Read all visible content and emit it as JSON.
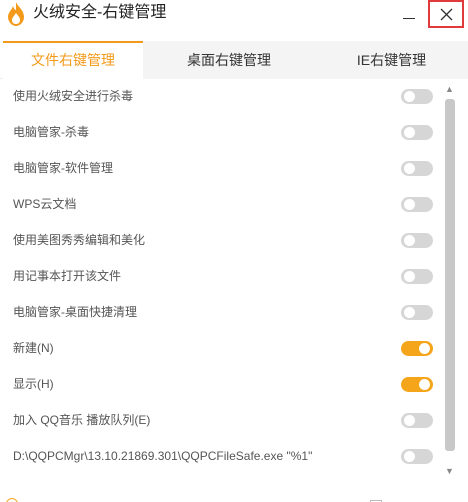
{
  "window": {
    "title": "火绒安全-右键管理"
  },
  "tabs": [
    {
      "label": "文件右键管理",
      "active": true
    },
    {
      "label": "桌面右键管理",
      "active": false
    },
    {
      "label": "IE右键管理",
      "active": false
    }
  ],
  "items": [
    {
      "label": "使用火绒安全进行杀毒",
      "enabled": false
    },
    {
      "label": "电脑管家-杀毒",
      "enabled": false
    },
    {
      "label": "电脑管家-软件管理",
      "enabled": false
    },
    {
      "label": "WPS云文档",
      "enabled": false
    },
    {
      "label": "使用美图秀秀编辑和美化",
      "enabled": false
    },
    {
      "label": "用记事本打开该文件",
      "enabled": false
    },
    {
      "label": "电脑管家-桌面快捷清理",
      "enabled": false
    },
    {
      "label": "新建(N)",
      "enabled": true
    },
    {
      "label": "显示(H)",
      "enabled": true
    },
    {
      "label": "加入 QQ音乐 播放队列(E)",
      "enabled": false
    },
    {
      "label": "D:\\QQPCMgr\\13.10.21869.301\\QQPCFileSafe.exe \"%1\"",
      "enabled": false
    }
  ],
  "footer": {
    "note": "",
    "checkbox_label": ""
  },
  "colors": {
    "accent": "#f5a51a",
    "close_border": "#e03a3a",
    "toggle_off": "#d6d6d6"
  },
  "icons": {
    "logo": "flame-logo-icon",
    "minimize": "minimize-icon",
    "close": "close-icon"
  }
}
